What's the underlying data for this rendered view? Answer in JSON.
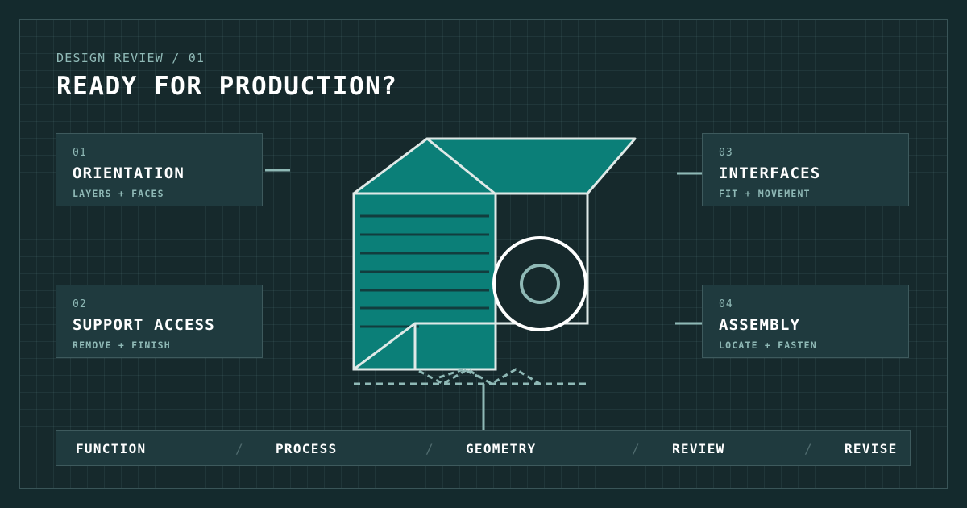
{
  "header": {
    "kicker": "DESIGN REVIEW / 01",
    "title": "READY FOR PRODUCTION?"
  },
  "cards": [
    {
      "num": "01",
      "name": "ORIENTATION",
      "sub": "LAYERS + FACES"
    },
    {
      "num": "02",
      "name": "SUPPORT ACCESS",
      "sub": "REMOVE + FINISH"
    },
    {
      "num": "03",
      "name": "INTERFACES",
      "sub": "FIT + MOVEMENT"
    },
    {
      "num": "04",
      "name": "ASSEMBLY",
      "sub": "LOCATE + FASTEN"
    }
  ],
  "process": {
    "items": [
      "FUNCTION",
      "PROCESS",
      "GEOMETRY",
      "REVIEW",
      "REVISE"
    ],
    "separator": "/"
  },
  "colors": {
    "background": "#142a2d",
    "panel": "#1f3a3e",
    "accent_teal": "#0b7f78",
    "line": "#dfe9e7",
    "muted": "#8fb9b6"
  }
}
